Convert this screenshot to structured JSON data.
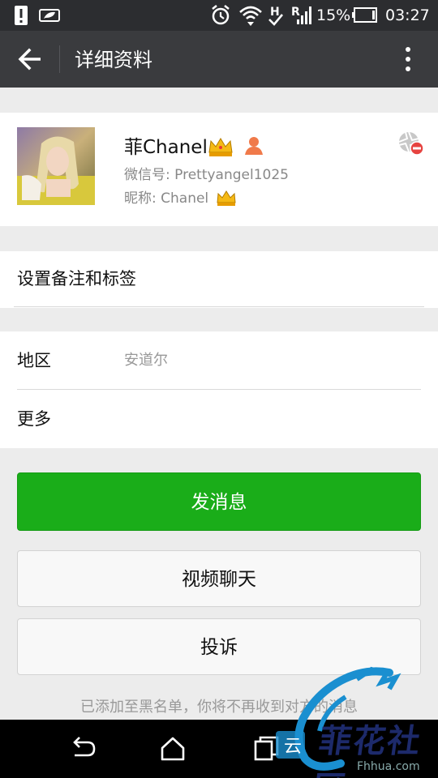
{
  "status_bar": {
    "battery_percent": "15%",
    "time": "03:27",
    "network_h": "H",
    "network_r": "R"
  },
  "header": {
    "title": "详细资料"
  },
  "profile": {
    "name": "菲Chanel",
    "wechat_id": "微信号: Prettyangel1025",
    "nickname": "昵称: Chanel"
  },
  "remark": {
    "label": "设置备注和标签"
  },
  "details": {
    "region_label": "地区",
    "region_value": "安道尔",
    "more_label": "更多"
  },
  "actions": {
    "send_message": "发消息",
    "video_call": "视频聊天",
    "report": "投诉"
  },
  "notice": "已添加至黑名单，你将不再收到对方的消息",
  "watermark": {
    "text": "菲花社区",
    "url": "Fhhua.com"
  },
  "colors": {
    "primary_green": "#1aad19",
    "title_bar": "#3a3b3e",
    "status_bar": "#2c2d30"
  }
}
